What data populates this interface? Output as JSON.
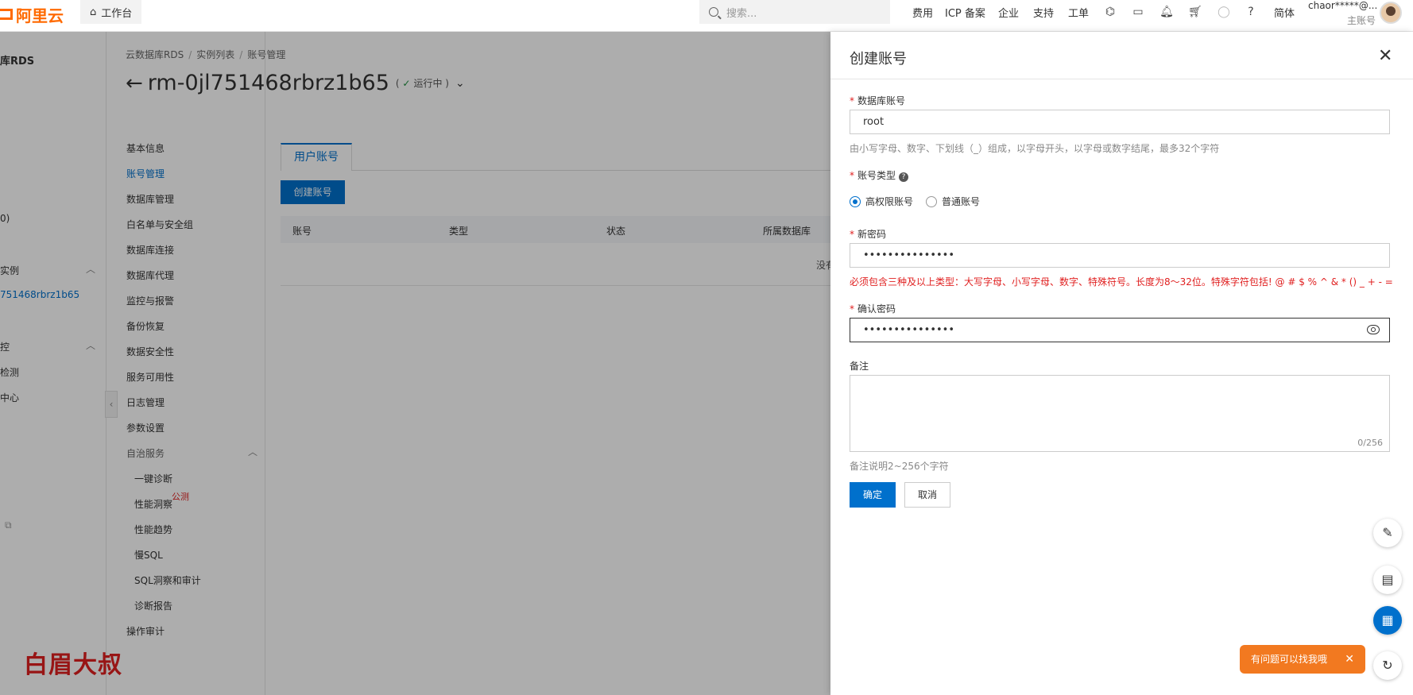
{
  "topbar": {
    "logo": "阿里云",
    "workspace": "工作台",
    "search_placeholder": "搜索...",
    "nav": [
      "费用",
      "ICP 备案",
      "企业",
      "支持",
      "工单"
    ],
    "lang": "简体",
    "user_name": "chaor*****@...",
    "user_role": "主账号"
  },
  "leftnav": {
    "product": "库RDS",
    "item_count": "0)",
    "group1": "实例",
    "instance_short": "751468rbrz1b65",
    "group2": "控",
    "item_detect": "检测",
    "item_center": "中心"
  },
  "secnav": {
    "items": [
      "基本信息",
      "账号管理",
      "数据库管理",
      "白名单与安全组",
      "数据库连接",
      "数据库代理",
      "监控与报警",
      "备份恢复",
      "数据安全性",
      "服务可用性",
      "日志管理",
      "参数设置",
      "自治服务"
    ],
    "sub_items": [
      "一键诊断",
      "性能洞察",
      "性能趋势",
      "慢SQL",
      "SQL洞察和审计",
      "诊断报告"
    ],
    "badge": "公测",
    "last": "操作审计"
  },
  "breadcrumb": [
    "云数据库RDS",
    "实例列表",
    "账号管理"
  ],
  "instance": {
    "id": "rm-0jl751468rbrz1b65",
    "status": "运行中"
  },
  "tabs": [
    "用户账号"
  ],
  "create_button": "创建账号",
  "table": {
    "headers": [
      "账号",
      "类型",
      "状态",
      "所属数据库"
    ],
    "empty": "没有"
  },
  "watermark": "白眉大叔",
  "drawer": {
    "title": "创建账号",
    "account_label": "数据库账号",
    "account_value": "root",
    "account_hint": "由小写字母、数字、下划线（_）组成，以字母开头，以字母或数字结尾，最多32个字符",
    "type_label": "账号类型",
    "type_options": [
      "高权限账号",
      "普通账号"
    ],
    "type_selected": "高权限账号",
    "password_label": "新密码",
    "password_value": "•••••••••••••••",
    "password_hint": "必须包含三种及以上类型：大写字母、小写字母、数字、特殊符号。长度为8～32位。特殊字符包括! @ # $ % ^ & * () _ + - =",
    "confirm_label": "确认密码",
    "confirm_value": "•••••••••••••••",
    "remark_label": "备注",
    "remark_count": "0/256",
    "remark_hint": "备注说明2~256个字符",
    "ok": "确定",
    "cancel": "取消"
  },
  "help_bubble": "有问题可以找我哦"
}
